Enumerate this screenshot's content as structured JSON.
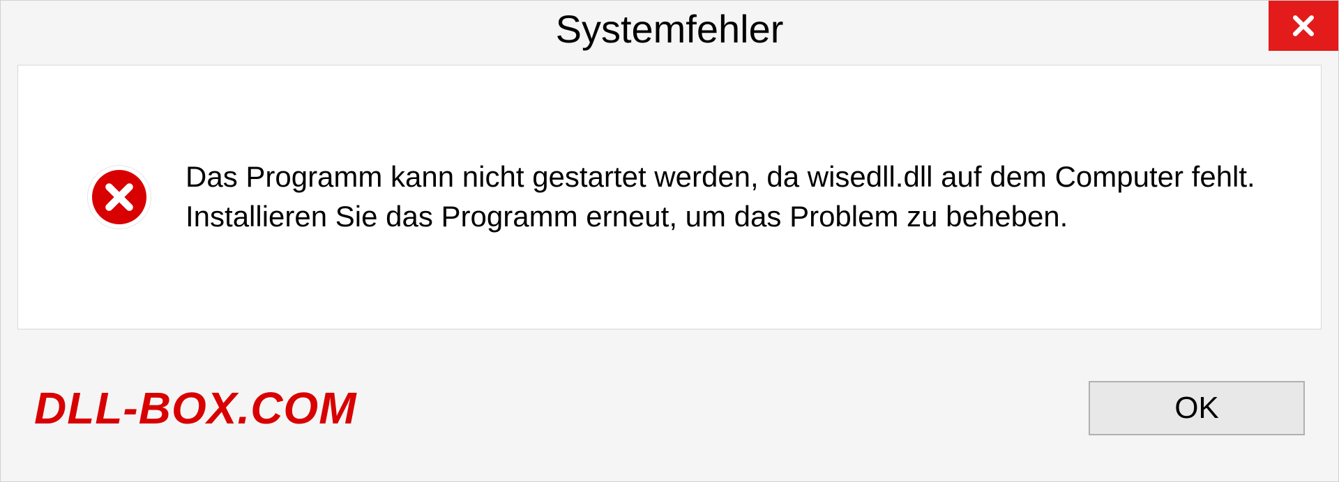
{
  "dialog": {
    "title": "Systemfehler",
    "message": "Das Programm kann nicht gestartet werden, da wisedll.dll auf dem Computer fehlt. Installieren Sie das Programm erneut, um das Problem zu beheben.",
    "ok_label": "OK",
    "watermark": "DLL-BOX.COM"
  }
}
